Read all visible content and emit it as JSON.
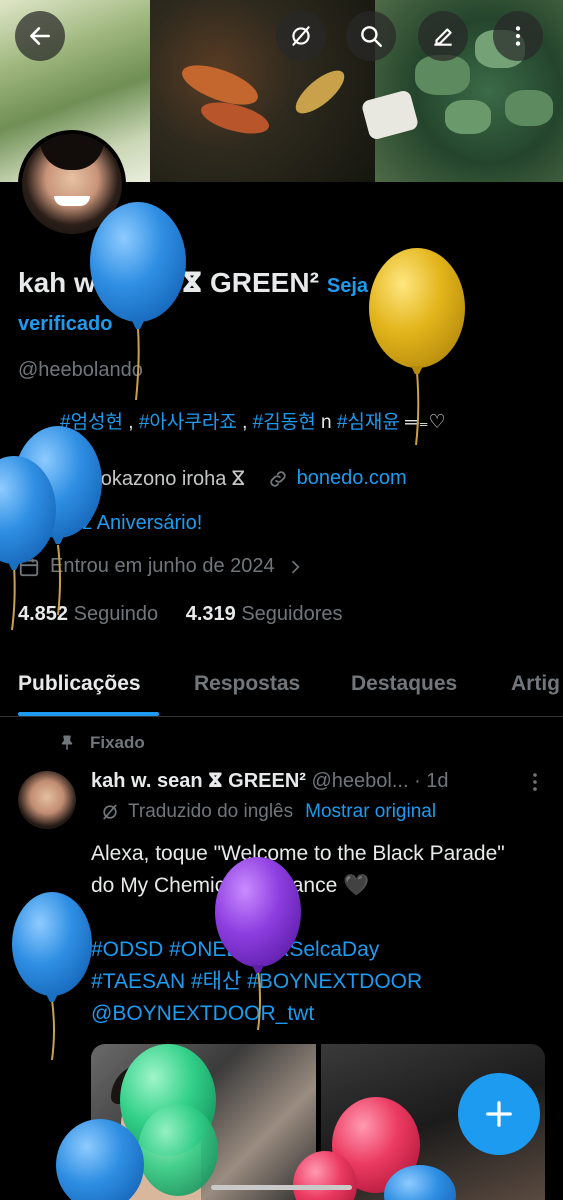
{
  "profile": {
    "name": "kah w. sean ⴵ GREEN²",
    "verify_prompt": "Seja",
    "verify_prompt_cont": "verificado",
    "handle": "@heebolando",
    "bio": {
      "tag1": "#엄성현",
      "sep1": " , ",
      "tag2": "#아사쿠라죠",
      "sep2": " , ",
      "tag3": "#김동현",
      "sep3": " n ",
      "tag4": "#심재윤",
      "tail": " ═₌♡"
    },
    "location": "hokazono iroha ⴵ",
    "location_prefix": "♡ ─ ୨୧",
    "website": "bonedo.com",
    "birthday": "Feliz Aniversário!",
    "joined": "Entrou em junho de 2024",
    "following_count": "4.852",
    "following_label": "Seguindo",
    "followers_count": "4.319",
    "followers_label": "Seguidores"
  },
  "tabs": [
    "Publicações",
    "Respostas",
    "Destaques",
    "Artig"
  ],
  "pinned_post": {
    "pinned_label": "Fixado",
    "author_name": "kah w. sean ⴵ GREEN²",
    "author_handle": "@heebol...",
    "time": "· 1d",
    "translated_label": "Traduzido do inglês",
    "show_original": "Mostrar original",
    "text": "Alexa, toque \"Welcome to the Black Parade\" do My Chemical Romance 🖤",
    "hashtags_line1": "#ODSD #ONEDOORSelcaDay",
    "hashtags_line2": "#TAESAN #태산 #BOYNEXTDOOR",
    "mention": "@BOYNEXTDOOR_twt"
  },
  "icons": {
    "back": "arrow-left-icon",
    "grok": "grok-icon",
    "search": "search-icon",
    "edit": "edit-icon",
    "more": "more-vertical-icon",
    "link": "link-icon",
    "balloon": "balloon-icon",
    "calendar": "calendar-icon",
    "pin": "pin-icon",
    "compose": "plus-icon"
  },
  "colors": {
    "accent": "#1d9bf0",
    "background": "#000000",
    "text": "#e7e9ea",
    "muted": "#71767b"
  }
}
